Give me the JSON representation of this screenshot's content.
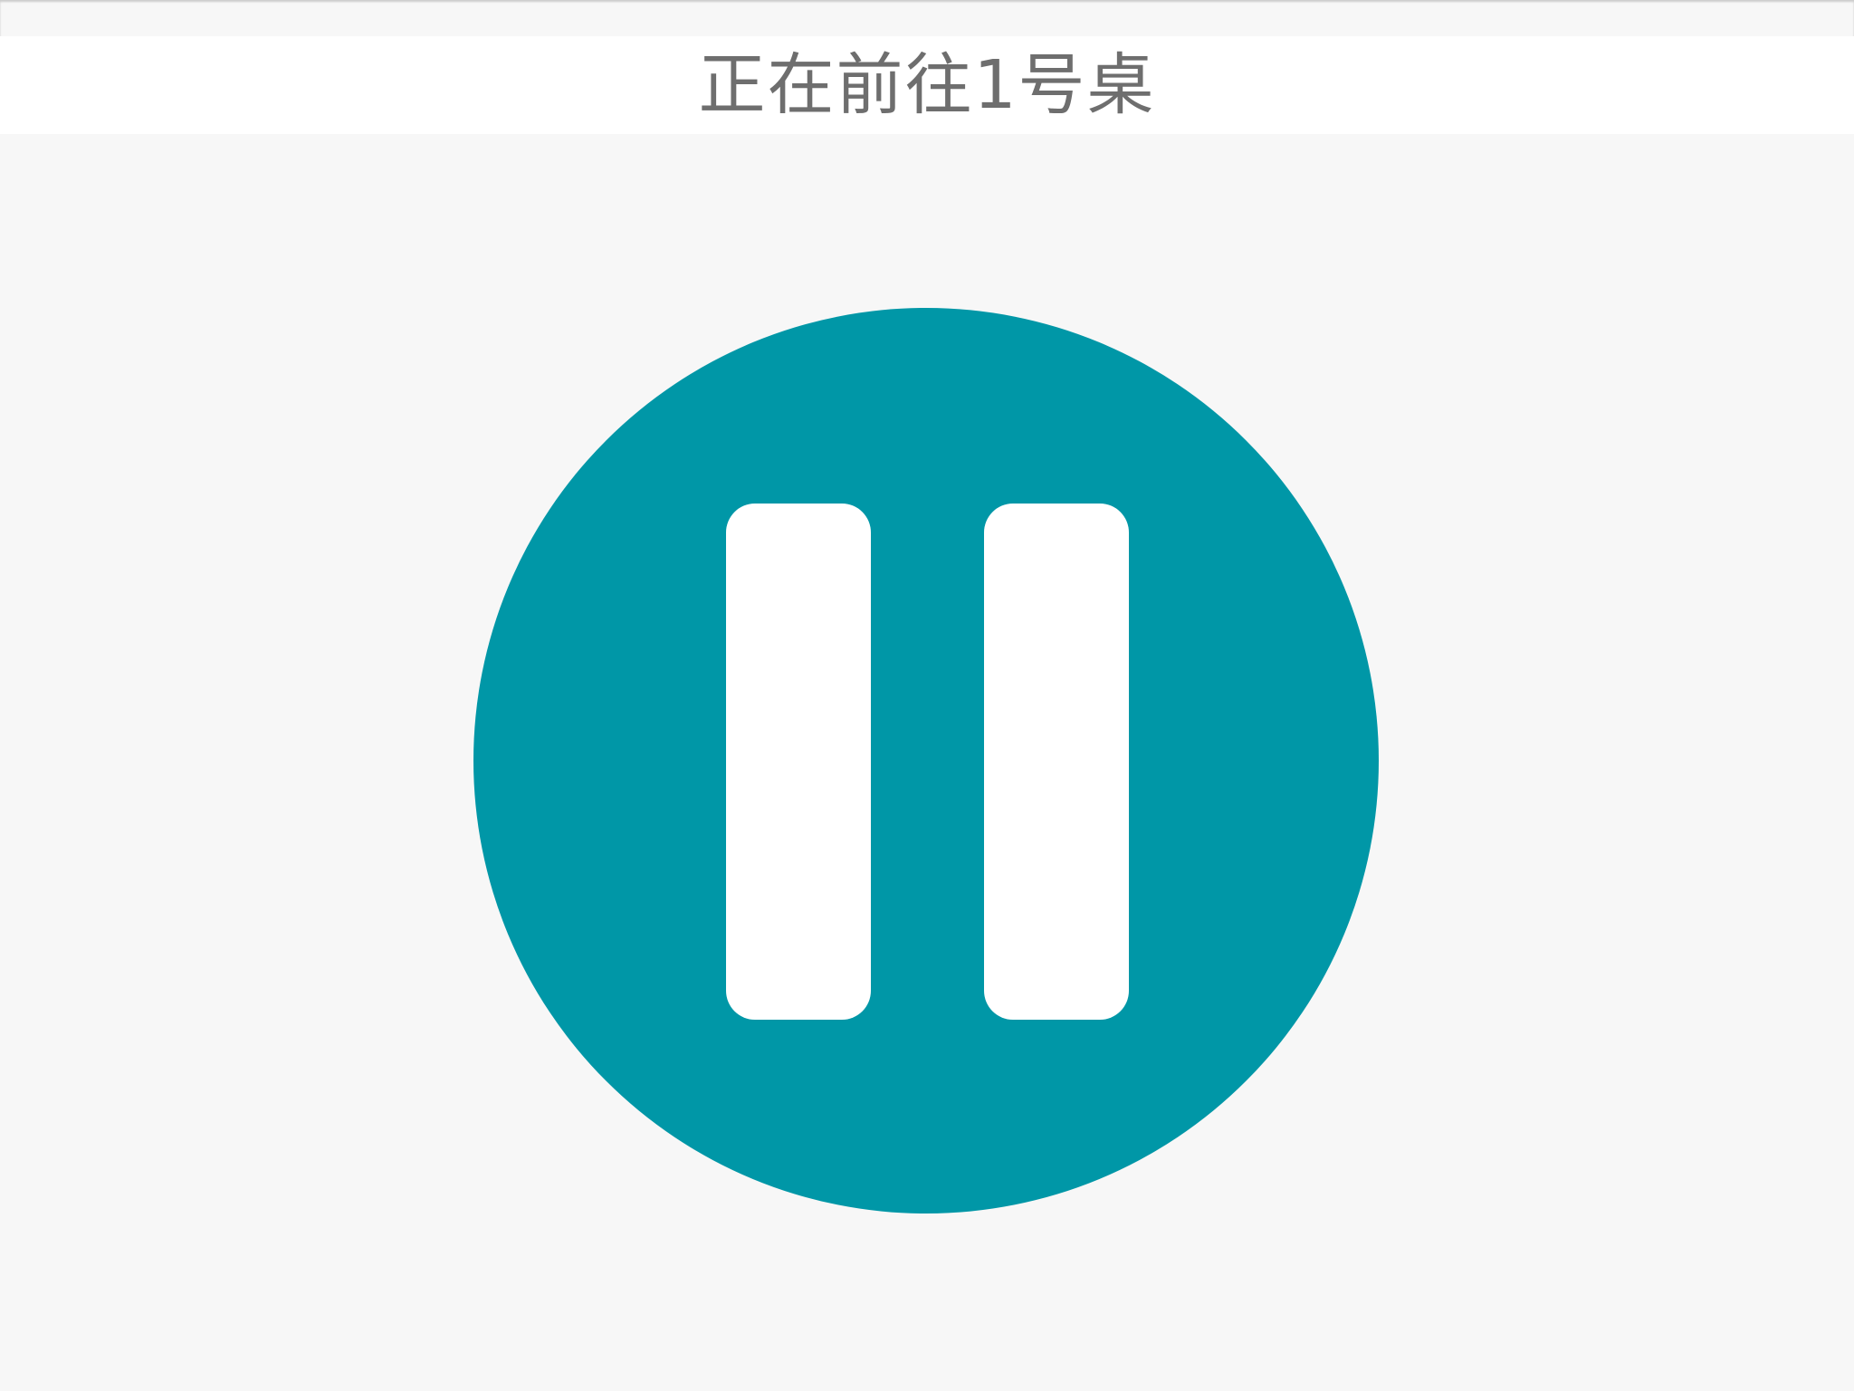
{
  "header": {
    "title": "正在前往1号桌"
  },
  "control": {
    "icon": "pause-icon",
    "state": "playing",
    "colors": {
      "button": "#0097a7",
      "icon": "#ffffff",
      "title_text": "#6e6e6e",
      "background": "#f7f7f7",
      "title_bar": "#ffffff"
    }
  }
}
